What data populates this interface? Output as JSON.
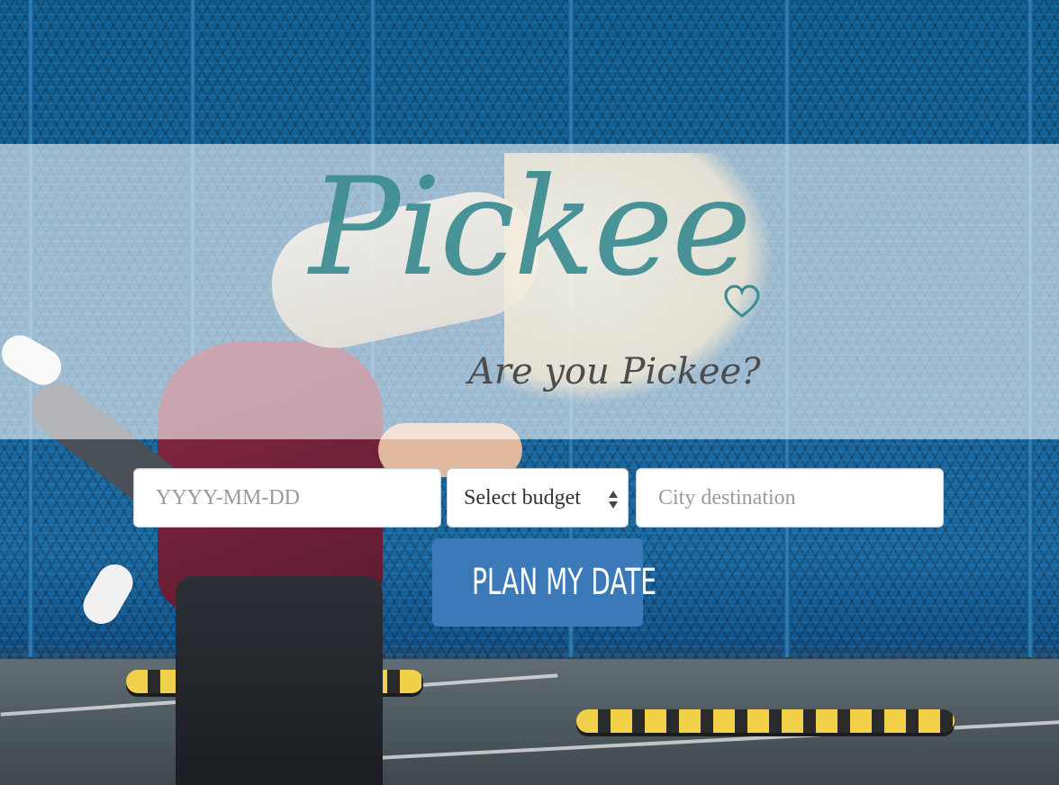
{
  "brand": {
    "logo_text": "Pickee",
    "tagline": "Are you Pickee?"
  },
  "form": {
    "date": {
      "placeholder": "YYYY-MM-DD",
      "value": ""
    },
    "budget": {
      "selected": "Select budget"
    },
    "city": {
      "placeholder": "City destination",
      "value": ""
    },
    "submit_label": "PLAN MY DATE"
  },
  "icons": {
    "logo_heart": "heart-outline-icon",
    "select_arrows": "up-down-arrows-icon"
  },
  "colors": {
    "logo": "#3b8c91",
    "tagline": "#4c4c4c",
    "button": "#3b79b8",
    "banner_overlay": "rgba(255,255,255,0.58)"
  }
}
